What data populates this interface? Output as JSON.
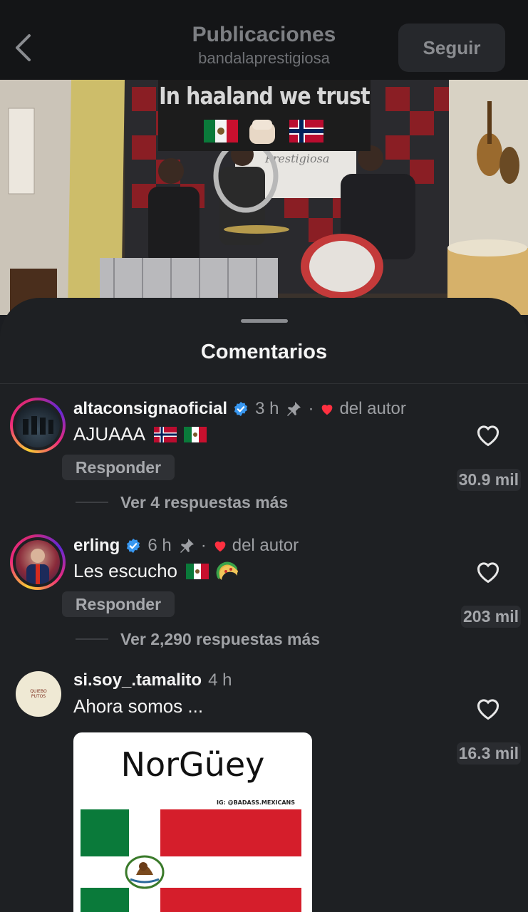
{
  "header": {
    "title": "Publicaciones",
    "subtitle": "bandalaprestigiosa",
    "follow_label": "Seguir",
    "back_icon": "chevron-left-icon"
  },
  "video": {
    "banner_text": "In haaland we trust",
    "banner_sign": "Prestigiosa"
  },
  "sheet": {
    "title": "Comentarios"
  },
  "comments": [
    {
      "username": "altaconsignaoficial",
      "verified": true,
      "time": "3 h",
      "pinned": true,
      "author_liked": "del autor",
      "text": "AJUAAA",
      "flags": [
        "norway",
        "mexico"
      ],
      "reply_label": "Responder",
      "likes": "30.9 mil",
      "replies": "Ver 4 respuestas más"
    },
    {
      "username": "erling",
      "verified": true,
      "time": "6 h",
      "pinned": true,
      "author_liked": "del autor",
      "text": "Les escucho",
      "flags": [
        "mexico",
        "taco"
      ],
      "reply_label": "Responder",
      "likes": "203 mil",
      "replies": "Ver 2,290 respuestas más"
    },
    {
      "username": "si.soy_.tamalito",
      "verified": false,
      "time": "4 h",
      "text": "Ahora somos ...",
      "likes": "16.3 mil",
      "avatar_text": "QUIEBO PUTOS",
      "meme": {
        "title": "NorGüey",
        "credit": "IG: @BADASS.MEXICANS"
      }
    }
  ],
  "colors": {
    "background": "#1e2023",
    "verified": "#3897f0",
    "heart_red": "#ff3040",
    "text_secondary": "#9d9fa3"
  }
}
